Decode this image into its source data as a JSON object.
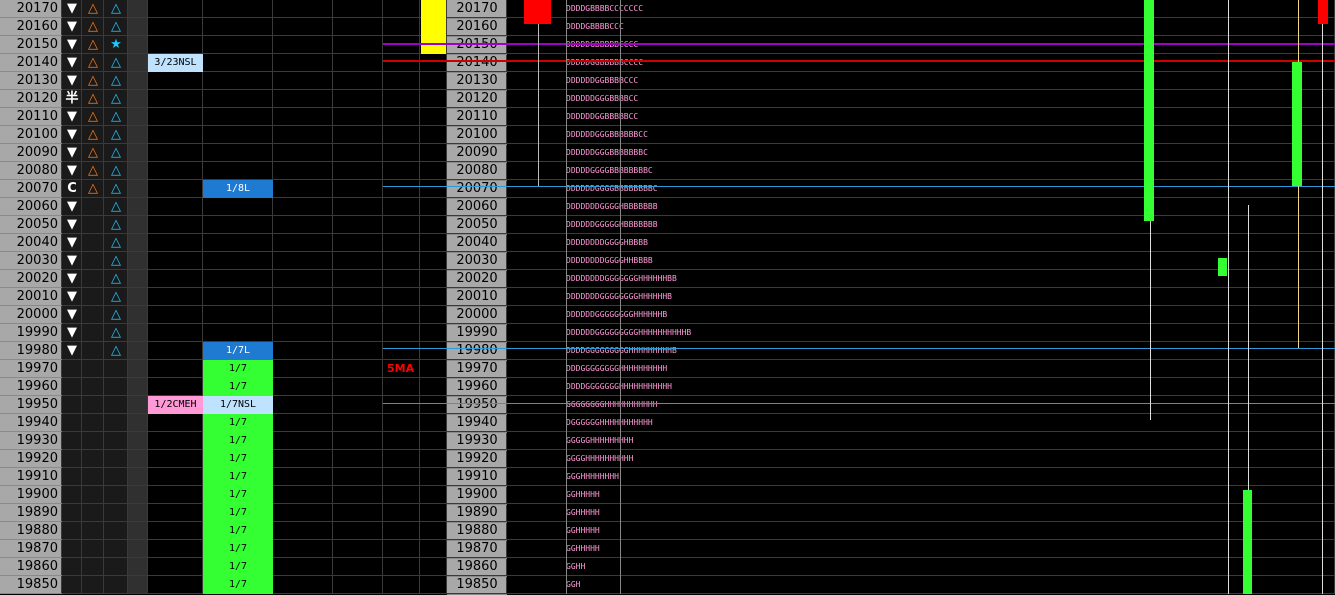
{
  "rows": [
    20170,
    20160,
    20150,
    20140,
    20130,
    20120,
    20110,
    20100,
    20090,
    20080,
    20070,
    20060,
    20050,
    20040,
    20030,
    20020,
    20010,
    20000,
    19990,
    19980,
    19970,
    19960,
    19950,
    19940,
    19930,
    19920,
    19910,
    19900,
    19890,
    19880,
    19870,
    19860,
    19850
  ],
  "symbols_col1": [
    "▼",
    "▼",
    "▼",
    "▼",
    "▼",
    "半",
    "▼",
    "▼",
    "▼",
    "▼",
    "C",
    "▼",
    "▼",
    "▼",
    "▼",
    "▼",
    "▼",
    "▼",
    "▼",
    "▼",
    "",
    "",
    "",
    "",
    "",
    "",
    "",
    "",
    "",
    "",
    "",
    "",
    ""
  ],
  "symbols_col2": [
    "△",
    "△",
    "△",
    "△",
    "△",
    "△",
    "△",
    "△",
    "△",
    "△",
    "△",
    "",
    "",
    "",
    "",
    "",
    "",
    "",
    "",
    "",
    "",
    "",
    "",
    "",
    "",
    "",
    "",
    "",
    "",
    "",
    "",
    "",
    ""
  ],
  "symbols_col3": [
    "△",
    "△",
    "★",
    "△",
    "△",
    "△",
    "△",
    "△",
    "△",
    "△",
    "△",
    "△",
    "△",
    "△",
    "△",
    "△",
    "△",
    "△",
    "△",
    "△",
    "",
    "",
    "",
    "",
    "",
    "",
    "",
    "",
    "",
    "",
    "",
    "",
    ""
  ],
  "markers": {
    "m323nsl": "3/23NSL",
    "m18l": "1/8L",
    "m17l": "1/7L",
    "m12cmeh": "1/2CMEH",
    "m17nsl": "1/7NSL",
    "fill_label": "1/7"
  },
  "ma_label": "5MA",
  "tpo": [
    "DDDDGBBBBCCCCCCC",
    "DDDDGBBBBCCC",
    "DDDDDGBBBBBCCCC",
    "DDDDDGGBBBBBCCCC",
    "DDDDDDGGBBBBCCC",
    "DDDDDDGGGBBBBCC",
    "DDDDDDGGBBBBBCC",
    "DDDDDDGGGBBBBBBCC",
    "DDDDDDGGGBBBBBBBC",
    "DDDDDGGGGBBBBBBBBC",
    "DDDDDDGGGGBBBBBBBBC",
    "DDDDDDDGGGGHBBBBBBB",
    "DDDDDDGGGGGHBBBBBBB",
    "DDDDDDDDGGGGHBBBB",
    "DDDDDDDDGGGGHHBBBB",
    "DDDDDDDDGGGGGGGHHHHHHBB",
    "DDDDDDDGGGGGGGGHHHHHHB",
    "DDDDDDGGGGGGGGHHHHHHB",
    "DDDDDDGGGGGGGGGHHHHHHHHHHB",
    "DDDDGGGGGGGGGHHHHHHHHHB",
    "DDDGGGGGGGGHHHHHHHHHH",
    "DDDDGGGGGGGHHHHHHHHHHH",
    "GGGGGGGGHHHHHHHHHHH",
    "DGGGGGGHHHHHHHHHHH",
    "GGGGGHHHHHHHHH",
    "GGGGHHHHHHHHHH",
    "GGGHHHHHHHH",
    "GGHHHHH",
    "GGHHHHH",
    "GGHHHHH",
    "GGHHHHH",
    "GGHH",
    "GGH"
  ],
  "colors": {
    "price_bg": "#a8a8a8",
    "grid": "#3a3a3a",
    "orange": "#ff7a1a",
    "cyan": "#1ec8ff",
    "green": "#33ff33",
    "yellow": "#ffff00",
    "red": "#ff0000",
    "blue_marker": "#1f7ad1",
    "light_blue": "#bfe3ff",
    "pink": "#ff9ad6",
    "purple": "#a000c8"
  }
}
